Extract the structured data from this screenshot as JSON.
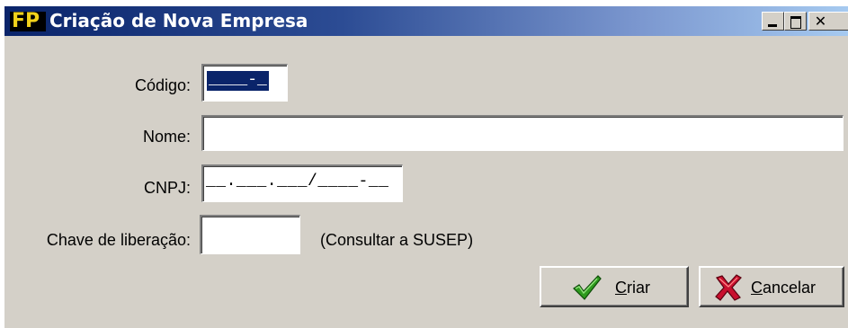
{
  "window": {
    "title": "Criação de Nova Empresa",
    "icon_text": "FP",
    "controls": [
      "minimize",
      "maximize",
      "close"
    ]
  },
  "form": {
    "codigo": {
      "label": "Código:",
      "value": "____-_"
    },
    "nome": {
      "label": "Nome:",
      "value": ""
    },
    "cnpj": {
      "label": "CNPJ:",
      "value": "__.___.___/____-__"
    },
    "chave": {
      "label": "Chave de liberação:",
      "value": "",
      "hint": "(Consultar a SUSEP)"
    }
  },
  "buttons": {
    "criar": {
      "label_first": "C",
      "label_rest": "riar",
      "icon": "checkmark-icon"
    },
    "cancelar": {
      "label_first": "C",
      "label_rest": "ancelar",
      "icon": "x-mark-icon"
    }
  },
  "colors": {
    "titlebar_start": "#0a246a",
    "titlebar_end": "#a6caf0",
    "face": "#d4d0c8",
    "selection": "#0a246a",
    "check_green": "#2e9a1e",
    "cancel_red": "#c8102e"
  }
}
